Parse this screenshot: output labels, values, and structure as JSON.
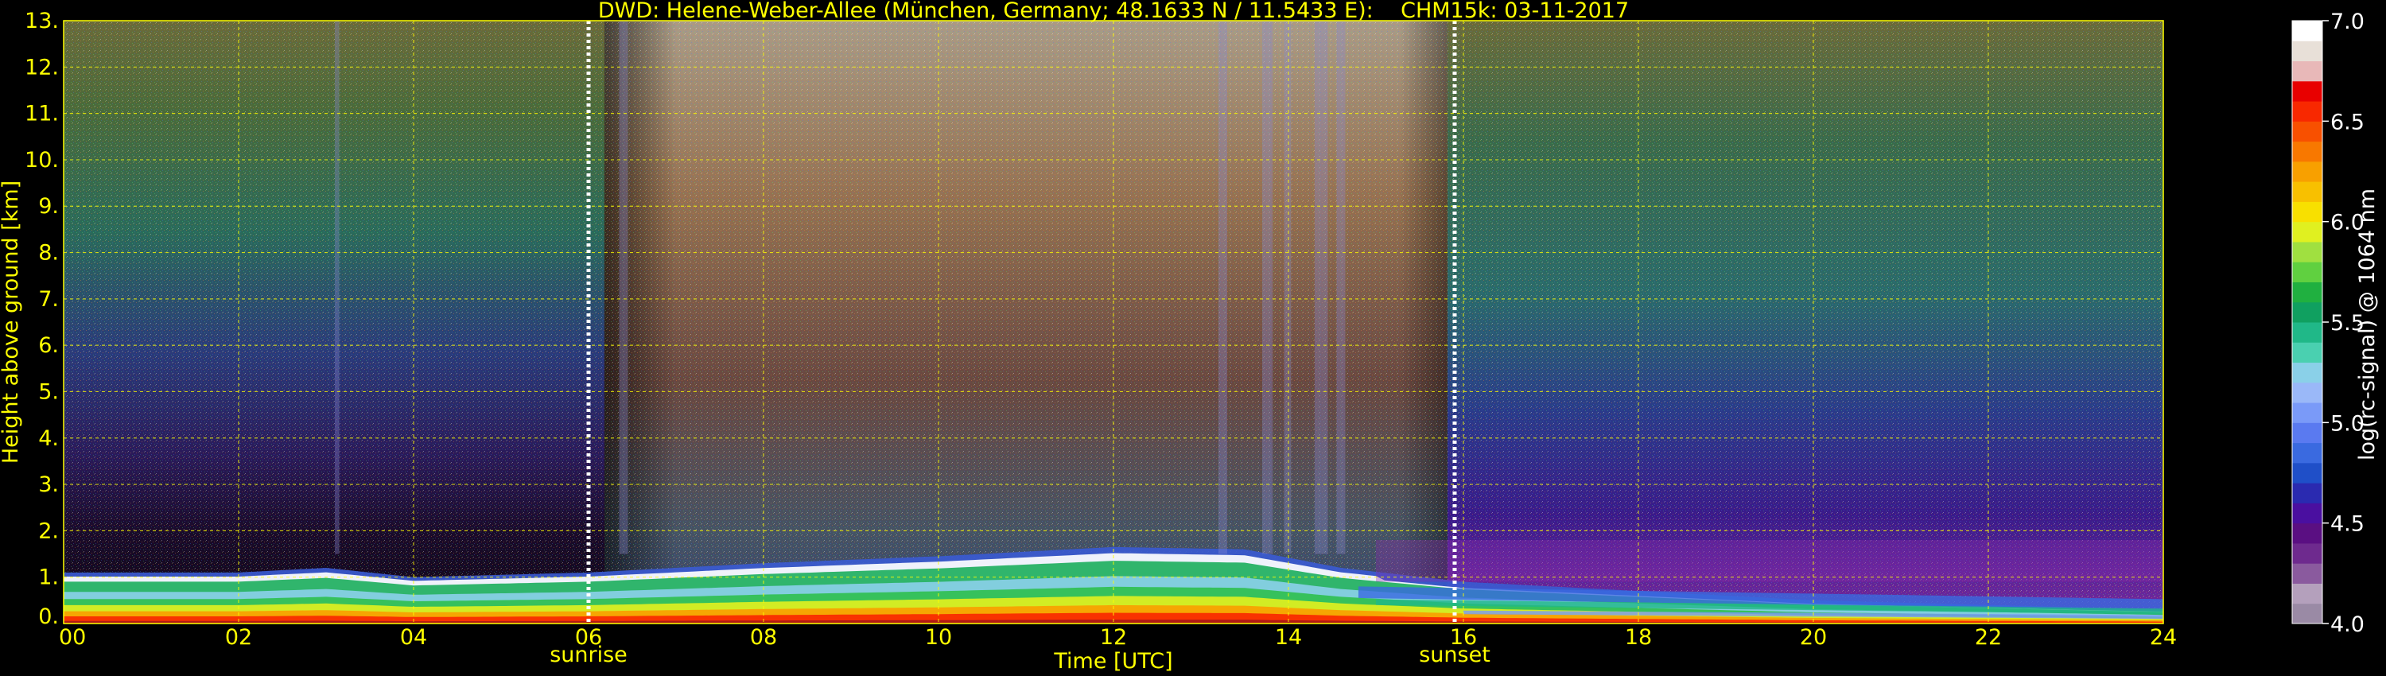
{
  "chart_data": {
    "type": "heatmap",
    "title": "DWD: Helene-Weber-Allee (München, Germany; 48.1633 N / 11.5433 E):    CHM15k: 03-11-2017",
    "xlabel": "Time [UTC]",
    "ylabel": "Height above ground [km]",
    "xlim": [
      0,
      24
    ],
    "ylim": [
      0,
      13
    ],
    "x_ticks": [
      "00",
      "02",
      "04",
      "06",
      "08",
      "10",
      "12",
      "14",
      "16",
      "18",
      "20",
      "22",
      "24"
    ],
    "y_ticks": [
      "0.",
      "1.",
      "2.",
      "3.",
      "4.",
      "5.",
      "6.",
      "7.",
      "8.",
      "9.",
      "10.",
      "11.",
      "12.",
      "13."
    ],
    "grid": true,
    "markers": [
      {
        "label": "sunrise",
        "time": 6.0
      },
      {
        "label": "sunset",
        "time": 15.9
      }
    ],
    "colorbar": {
      "label": "log(rc-signal) @ 1064 nm",
      "range": [
        4.0,
        7.0
      ],
      "ticks": [
        "4.0",
        "4.5",
        "5.0",
        "5.5",
        "6.0",
        "6.5",
        "7.0"
      ],
      "colors": [
        "#9a8aa5",
        "#b4a0bc",
        "#8a5a9e",
        "#6e2a8e",
        "#5a0f82",
        "#4a0fa0",
        "#2a2ab0",
        "#1f4fc8",
        "#3a6ae0",
        "#5a7af0",
        "#7a9af8",
        "#9ab8f8",
        "#8ad0e8",
        "#4ad0b0",
        "#20b888",
        "#10a060",
        "#20b040",
        "#60d040",
        "#a0e040",
        "#e0f020",
        "#f8e000",
        "#f8c000",
        "#f8a000",
        "#f87800",
        "#f85000",
        "#f82800",
        "#e80000",
        "#e8b8b8",
        "#e8e0d8",
        "#ffffff"
      ]
    },
    "series_description_layers": {
      "boundary_layer_top_km": [
        {
          "t": 0,
          "h": 1.1
        },
        {
          "t": 2,
          "h": 1.1
        },
        {
          "t": 3,
          "h": 1.2
        },
        {
          "t": 4,
          "h": 1.0
        },
        {
          "t": 6,
          "h": 1.1
        },
        {
          "t": 8,
          "h": 1.3
        },
        {
          "t": 10,
          "h": 1.45
        },
        {
          "t": 12,
          "h": 1.65
        },
        {
          "t": 13.5,
          "h": 1.6
        },
        {
          "t": 14.6,
          "h": 1.2
        },
        {
          "t": 16,
          "h": 0.9
        },
        {
          "t": 20,
          "h": 0.5
        },
        {
          "t": 24,
          "h": 0.3
        }
      ]
    }
  }
}
